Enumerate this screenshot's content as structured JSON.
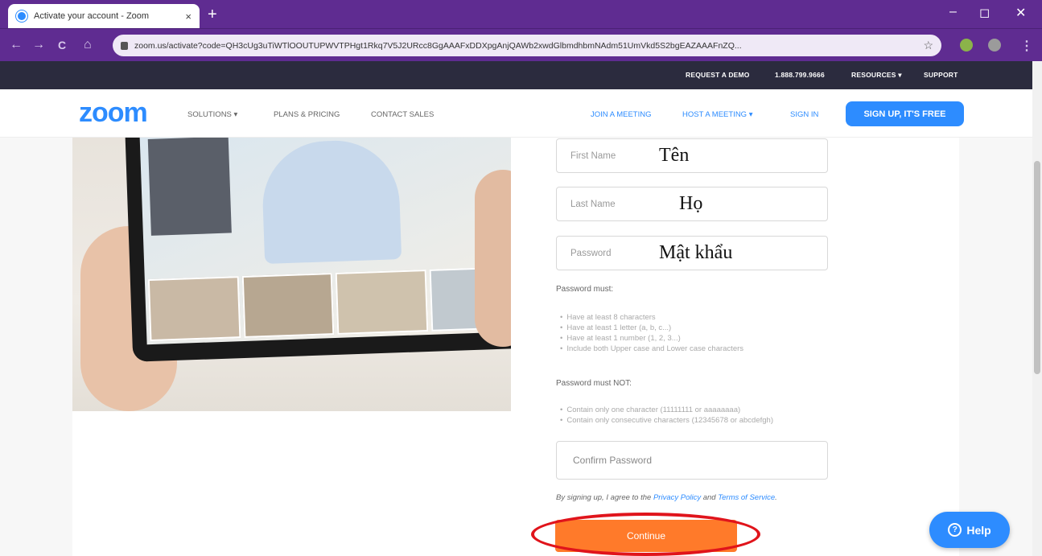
{
  "browser": {
    "tab_title": "Activate your account - Zoom",
    "tab_close": "×",
    "new_tab": "+",
    "url": "zoom.us/activate?code=QH3cUg3uTiWTlOOUTUPWVTPHgt1Rkq7V5J2URcc8GgAAAFxDDXpgAnjQAWb2xwdGlbmdhbmNAdm51UmVkd5S2bgEAZAAAFnZQ...",
    "controls": {
      "minimize": "‒",
      "maximize": "◻",
      "close": "✕"
    },
    "nav": {
      "back": "←",
      "forward": "→",
      "reload": "C",
      "home": "⌂"
    }
  },
  "topstrip": {
    "request_demo": "REQUEST A DEMO",
    "phone": "1.888.799.9666",
    "resources": "RESOURCES ▾",
    "support": "SUPPORT"
  },
  "nav": {
    "logo": "zoom",
    "solutions": "SOLUTIONS ▾",
    "plans": "PLANS & PRICING",
    "contact": "CONTACT SALES",
    "join": "JOIN A MEETING",
    "host": "HOST A MEETING ▾",
    "signin": "SIGN IN",
    "signup": "SIGN UP, IT'S FREE"
  },
  "form": {
    "first_name_placeholder": "First Name",
    "first_name_annotation": "Tên",
    "last_name_placeholder": "Last Name",
    "last_name_annotation": "Họ",
    "password_placeholder": "Password",
    "password_annotation": "Mật khẩu",
    "must_title": "Password must:",
    "must_items": [
      "Have at least 8 characters",
      "Have at least 1 letter (a, b, c...)",
      "Have at least 1 number (1, 2, 3...)",
      "Include both Upper case and Lower case characters"
    ],
    "must_not_title": "Password must NOT:",
    "must_not_items": [
      "Contain only one character (11111111 or aaaaaaaa)",
      "Contain only consecutive characters (12345678 or abcdefgh)"
    ],
    "confirm_placeholder": "Confirm Password",
    "terms_prefix": "By signing up, I agree to the ",
    "privacy": "Privacy Policy",
    "terms_and": " and ",
    "terms": "Terms of Service",
    "terms_suffix": ".",
    "continue": "Continue"
  },
  "help": {
    "label": "Help",
    "icon": "?"
  },
  "colors": {
    "brand": "#2d8cff",
    "continue": "#ff7a2a",
    "chrome": "#5f2c91",
    "annotation_oval": "#e0141b"
  }
}
